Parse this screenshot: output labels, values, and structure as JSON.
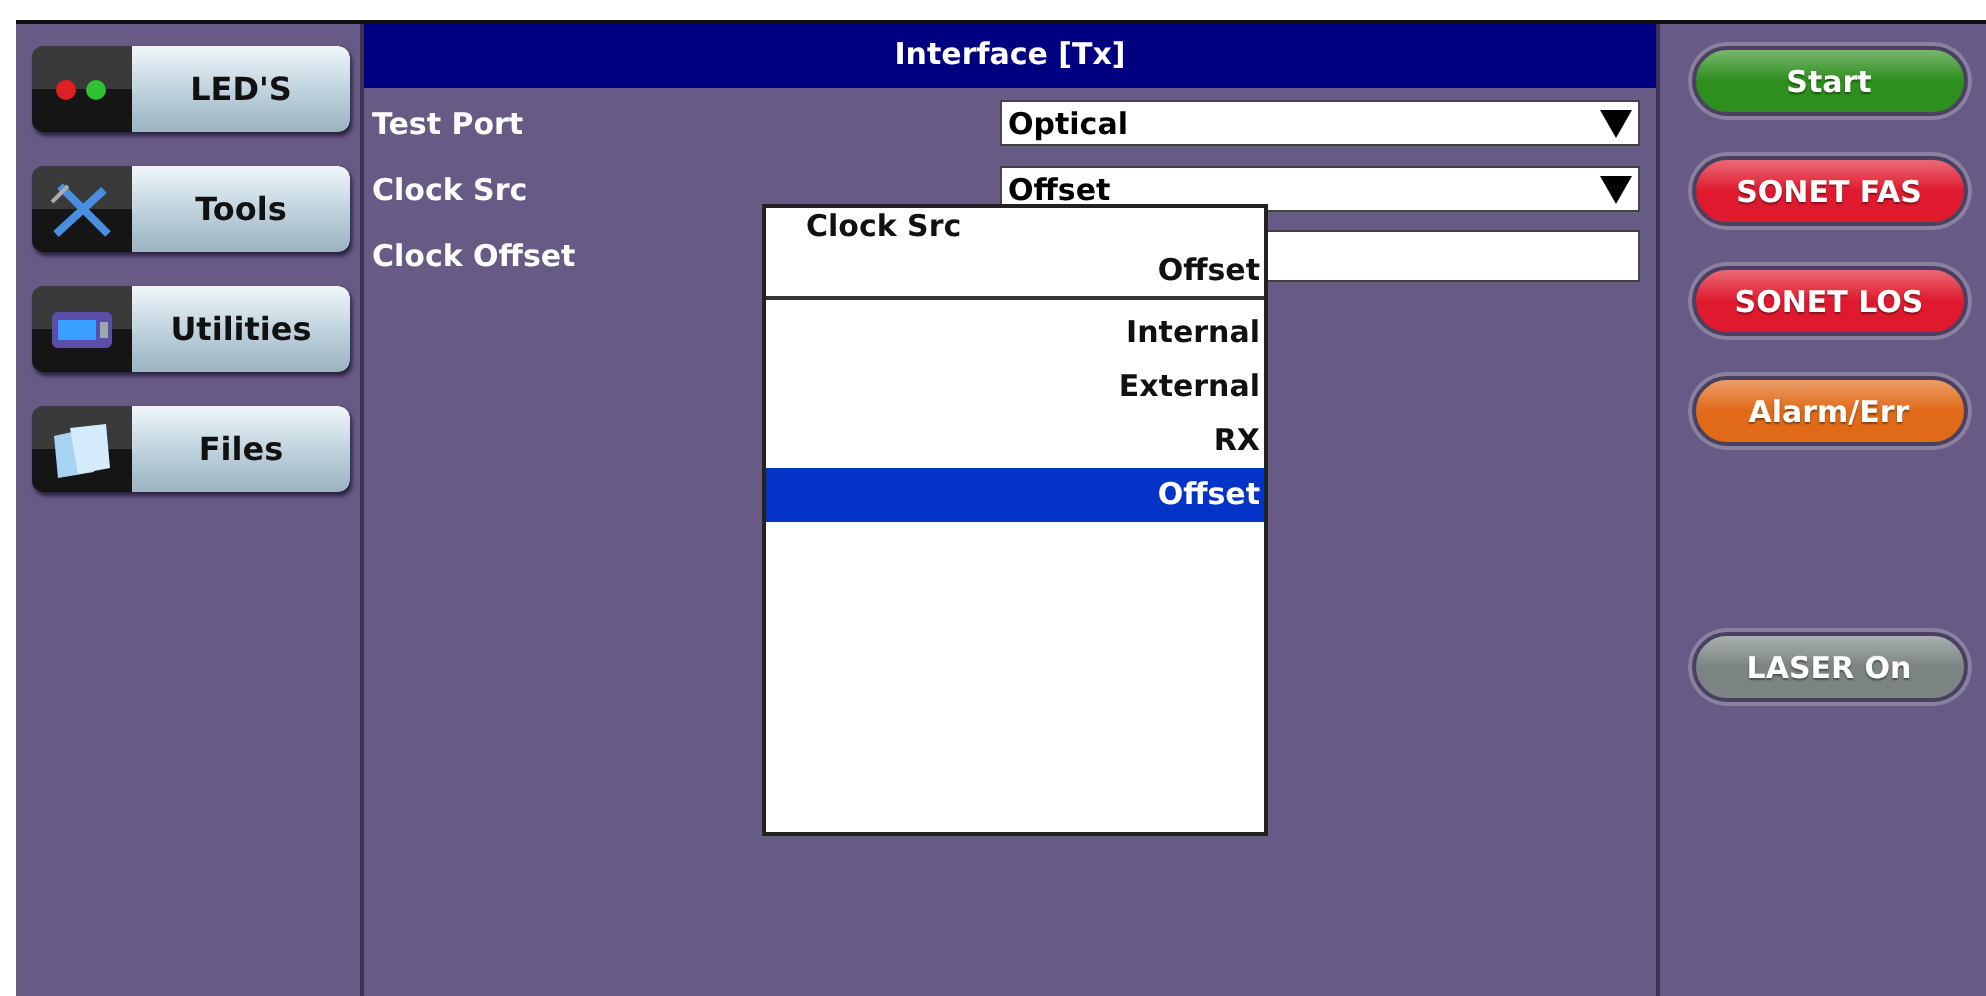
{
  "sidebar": {
    "items": [
      {
        "label": "LED'S",
        "kind": "leds"
      },
      {
        "label": "Tools",
        "kind": "tools"
      },
      {
        "label": "Utilities",
        "kind": "utilities"
      },
      {
        "label": "Files",
        "kind": "files"
      }
    ]
  },
  "panel": {
    "title": "Interface [Tx]",
    "fields": [
      {
        "label": "Test Port",
        "kind": "select",
        "value": "Optical"
      },
      {
        "label": "Clock Src",
        "kind": "select",
        "value": "Offset"
      },
      {
        "label": "Clock Offset",
        "kind": "input"
      }
    ]
  },
  "popup": {
    "title": "Clock Src",
    "current": "Offset",
    "options": [
      {
        "label": "Internal",
        "selected": false
      },
      {
        "label": "External",
        "selected": false
      },
      {
        "label": "RX",
        "selected": false
      },
      {
        "label": "Offset",
        "selected": true
      }
    ]
  },
  "actions": [
    {
      "label": "Start",
      "color": "#2f8f1e"
    },
    {
      "label": "SONET FAS",
      "color": "#e01a2e"
    },
    {
      "label": "SONET LOS",
      "color": "#e01a2e"
    },
    {
      "label": "Alarm/Err",
      "color": "#e06a18"
    }
  ],
  "bottom_actions": [
    {
      "label": "LASER On",
      "color": "#7c8484"
    }
  ]
}
